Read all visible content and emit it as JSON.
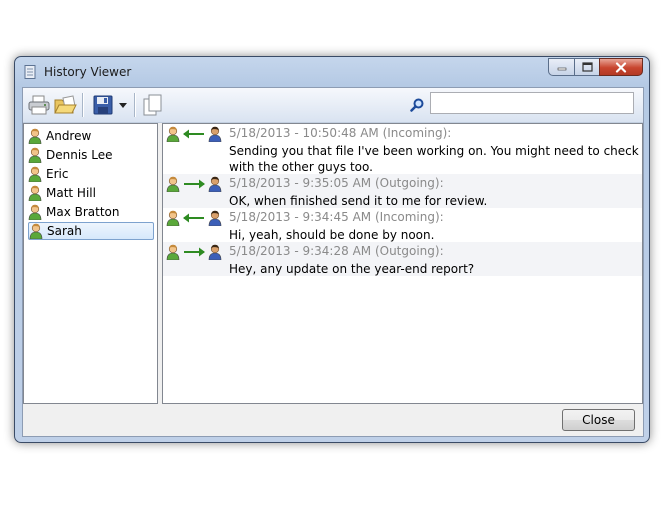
{
  "window": {
    "title": "History Viewer",
    "accent": "#c5d6ec"
  },
  "toolbar": {
    "icons": [
      "print-icon",
      "open-folder-icon",
      "save-icon",
      "dropdown-arrow-icon",
      "copy-icon",
      "search-icon"
    ],
    "search_value": ""
  },
  "contacts": [
    {
      "name": "Andrew"
    },
    {
      "name": "Dennis Lee"
    },
    {
      "name": "Eric"
    },
    {
      "name": "Matt Hill"
    },
    {
      "name": "Max Bratton"
    },
    {
      "name": "Sarah",
      "selected": true
    }
  ],
  "messages": [
    {
      "header": "5/18/2013 - 10:50:48 AM (Incoming):",
      "body": "Sending you that file I've been working on. You might need to check with the other guys too.",
      "direction": "incoming"
    },
    {
      "header": "5/18/2013 - 9:35:05 AM (Outgoing):",
      "body": "OK, when finished send it to me for review.",
      "direction": "outgoing"
    },
    {
      "header": "5/18/2013 - 9:34:45 AM (Incoming):",
      "body": "Hi, yeah, should be done by noon.",
      "direction": "incoming"
    },
    {
      "header": "5/18/2013 - 9:34:28 AM (Outgoing):",
      "body": "Hey, any update on the year-end report?",
      "direction": "outgoing"
    }
  ],
  "footer": {
    "close_label": "Close"
  }
}
